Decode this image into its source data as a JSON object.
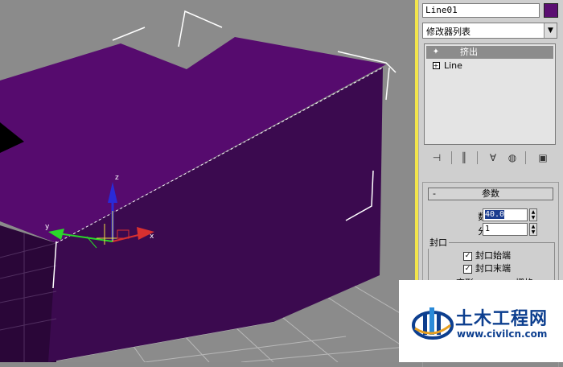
{
  "panel": {
    "object_name": "Line01",
    "object_color": "#5b0e72",
    "modifier_list": "修改器列表",
    "stack": [
      {
        "label": "挤出",
        "icon": "lightbulb-icon",
        "selected": true
      },
      {
        "label": "Line",
        "icon": "plus-box-icon",
        "selected": false
      }
    ],
    "stack_tools": [
      "pin-stack-icon",
      "show-end-result-icon",
      "make-unique-icon",
      "remove-modifier-icon",
      "configure-modifier-sets-icon"
    ],
    "rollout": {
      "collapse_symbol": "-",
      "title": "参数",
      "amount_label": "数量:",
      "amount_value": "40.0",
      "segments_label": "分段:",
      "segments_value": "1",
      "cap_group_title": "封口",
      "cap_start_label": "封口始端",
      "cap_end_label": "封口末端",
      "cap_start_checked": true,
      "cap_end_checked": true,
      "morph_label": "变形",
      "grid_label": "栅格"
    }
  },
  "viewport": {
    "object_color": "#560b6e",
    "axis_z_label": "z",
    "axis_x_label": "x",
    "axis_y_label": "y"
  },
  "watermark": {
    "title": "土木工程网",
    "url": "www.civilcn.com"
  }
}
